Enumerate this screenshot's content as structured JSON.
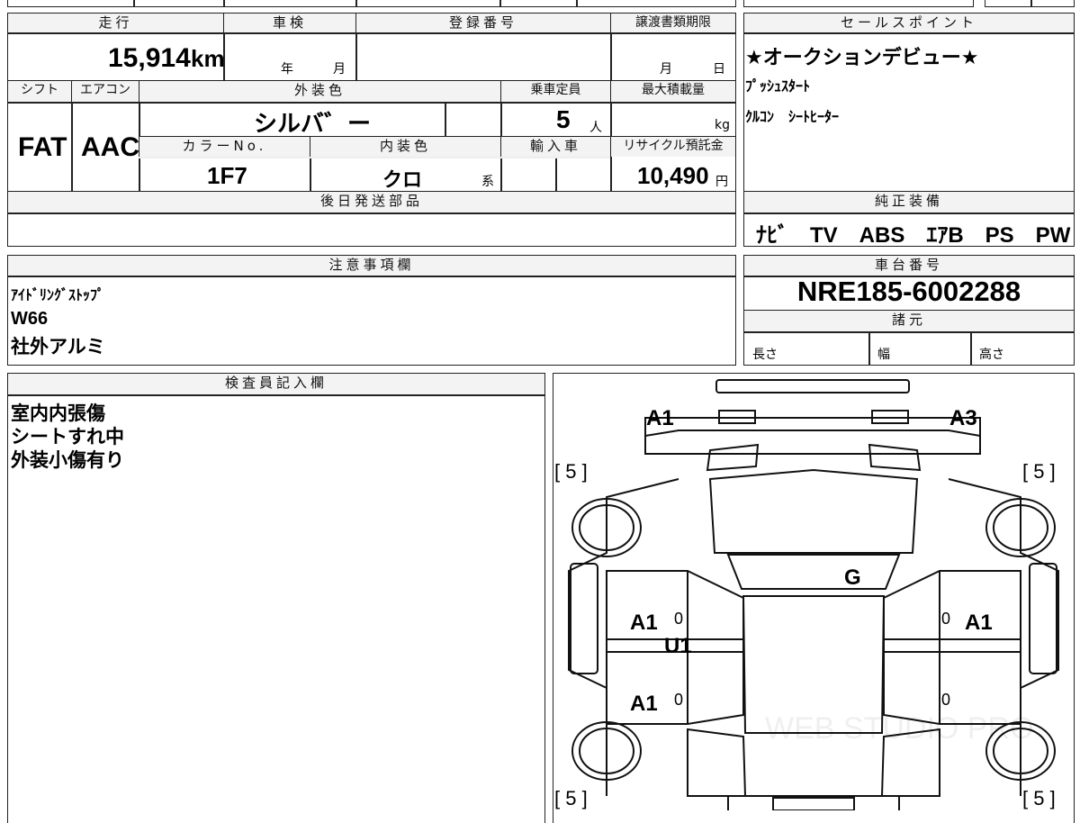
{
  "sheet": {
    "headers": {
      "mileage": "走行",
      "shaken": "車検",
      "registration": "登録番号",
      "transfer_deadline": "譲渡書類期限",
      "shift": "シフト",
      "aircon": "エアコン",
      "exterior_color": "外装色",
      "capacity": "乗車定員",
      "max_load": "最大積載量",
      "color_no": "カラーNo.",
      "interior_color": "内装色",
      "import": "輸入車",
      "recycle": "リサイクル預託金",
      "later_parts": "後日発送部品",
      "sales_point": "セールスポイント",
      "factory_equipment": "純正装備",
      "notes": "注意事項欄",
      "chassis_no": "車台番号",
      "specs": "諸元",
      "inspector": "検査員記入欄"
    },
    "values": {
      "mileage": "15,914",
      "mileage_unit": "km",
      "year_unit": "年",
      "month_unit": "月",
      "deadline_month": "月",
      "deadline_day": "日",
      "shift": "FAT",
      "aircon": "AAC",
      "exterior_color": "シルバ゛ー",
      "capacity": "5",
      "capacity_unit": "人",
      "load_unit": "kg",
      "color_no": "1F7",
      "interior_color": "クロ",
      "interior_suffix": "系",
      "recycle": "10,490",
      "recycle_unit": "円",
      "chassis_no": "NRE185-6002288",
      "spec_length": "長さ",
      "spec_width": "幅",
      "spec_height": "高さ"
    },
    "sales_points": [
      "★オークションデビュー★",
      "ﾌﾟｯｼｭｽﾀｰﾄ",
      "ｸﾙｺﾝ　ｼｰﾄﾋｰﾀｰ"
    ],
    "equipment": "ﾅﾋﾞ　TV　ABS　ｴｱB　PS　PW",
    "notes_lines": [
      "ｱｲﾄﾞﾘﾝｸﾞｽﾄｯﾌﾟ",
      "W66",
      "社外アルミ"
    ],
    "inspector_lines": [
      "室内内張傷",
      "シートすれ中",
      "外装小傷有り"
    ]
  },
  "diagram": {
    "tread_left_top": "[ 5 ]",
    "tread_right_top": "[ 5 ]",
    "tread_left_bottom": "[ 5 ]",
    "tread_right_bottom": "[ 5 ]",
    "marks": {
      "front_left": "A1",
      "front_right": "A3",
      "windshield": "G",
      "left_front_door": "A1",
      "left_lower": "U1",
      "left_rear_door": "A1",
      "right_front_door": "A1"
    },
    "zeros": [
      "0",
      "0",
      "0",
      "0"
    ],
    "watermark": "WEB STUDIO PRO"
  }
}
